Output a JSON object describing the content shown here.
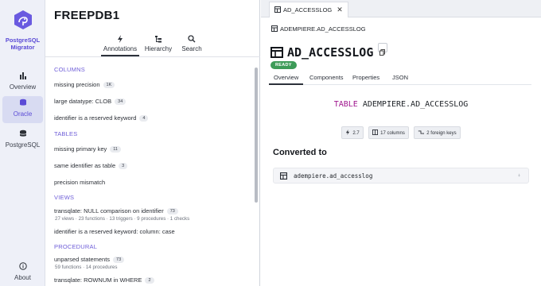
{
  "brand": {
    "line1": "PostgreSQL",
    "line2": "Migrator"
  },
  "rail": {
    "overview": "Overview",
    "oracle": "Oracle",
    "postgresql": "PostgreSQL",
    "about": "About"
  },
  "middle": {
    "title": "FREEPDB1",
    "tabs": {
      "annotations": "Annotations",
      "hierarchy": "Hierarchy",
      "search": "Search"
    },
    "sections": {
      "columns": "COLUMNS",
      "tables": "TABLES",
      "views": "VIEWS",
      "procedural": "PROCEDURAL"
    },
    "issues": {
      "missing_precision": {
        "label": "missing precision",
        "count": "1K"
      },
      "large_datatype": {
        "label": "large datatype: CLOB",
        "count": "34"
      },
      "reserved_identifier": {
        "label": "identifier is a reserved keyword",
        "count": "4"
      },
      "missing_pk": {
        "label": "missing primary key",
        "count": "11"
      },
      "same_identifier": {
        "label": "same identifier as table",
        "count": "3"
      },
      "precision_mismatch": {
        "label": "precision mismatch"
      },
      "transqlate_null": {
        "label": "transqlate: NULL comparison on identifier",
        "count": "73",
        "meta": "27 views · 23 functions · 13 triggers · 9 procedures · 1 checks"
      },
      "reserved_column_case": {
        "label": "identifier is a reserved keyword: column: case"
      },
      "unparsed": {
        "label": "unparsed statements",
        "count": "73",
        "meta": "59 functions · 14 procedures"
      },
      "rownum": {
        "label": "transqlate: ROWNUM in WHERE",
        "count": "2"
      }
    }
  },
  "right": {
    "tab_label": "AD_ACCESSLOG",
    "breadcrumb": "ADEMPIERE.AD_ACCESSLOG",
    "heading": "AD_ACCESSLOG",
    "status": "READY",
    "tabs": {
      "overview": "Overview",
      "components": "Components",
      "properties": "Properties",
      "json": "JSON"
    },
    "sql_keyword": "TABLE",
    "sql_name": "ADEMPIERE.AD_ACCESSLOG",
    "chips": {
      "score": "2.7",
      "columns": "17 columns",
      "fks": "2 foreign keys"
    },
    "converted_heading": "Converted to",
    "converted_target": "adempiere.ad_accesslog"
  },
  "colors": {
    "accent": "#5b4bd6",
    "ready": "#3d9b58",
    "keyword": "#a0168e"
  }
}
